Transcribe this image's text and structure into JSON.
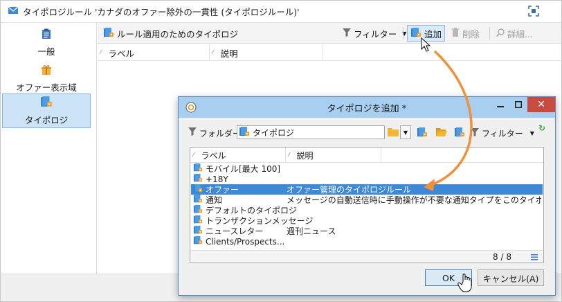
{
  "window": {
    "title": "タイポロジルール 'カナダのオファー除外の一貫性 (タイポロジルール)'"
  },
  "sidebar": {
    "items": [
      {
        "label": "一般",
        "icon": "clipboard-icon",
        "active": false
      },
      {
        "label": "オファー表示域",
        "icon": "gift-icon",
        "active": false
      },
      {
        "label": "タイポロジ",
        "icon": "typology-folder-icon",
        "active": true
      }
    ]
  },
  "toolbar": {
    "section_title": "ルール適用のためのタイポロジ",
    "filter_label": "フィルター",
    "add_label": "追加",
    "delete_label": "削除",
    "details_label": "詳細..."
  },
  "list": {
    "columns": [
      "ラベル",
      "説明"
    ]
  },
  "dialog": {
    "title": "タイポロジを追加 *",
    "folder_label": "フォルダー:",
    "folder_value": "タイポロジ",
    "filter_label": "フィルター",
    "columns": [
      "ラベル",
      "説明"
    ],
    "rows": [
      {
        "label": "モバイル[最大 100]",
        "description": "",
        "selected": false
      },
      {
        "label": "+18Y",
        "description": "",
        "selected": false
      },
      {
        "label": "オファー",
        "description": "オファー管理のタイポロジルール",
        "selected": true
      },
      {
        "label": "通知",
        "description": "メッセージの自動送信時に手動操作が不要な通知タイプをこのタイポロジ...",
        "selected": false
      },
      {
        "label": "デフォルトのタイポロジ",
        "description": "",
        "selected": false
      },
      {
        "label": "トランザクションメッセージ",
        "description": "",
        "selected": false
      },
      {
        "label": "ニュースレター",
        "description": "週刊ニュース",
        "selected": false
      },
      {
        "label": "Clients/Prospects...",
        "description": "",
        "selected": false
      }
    ],
    "count": "8 / 8",
    "ok_label": "OK",
    "cancel_label": "キャンセル(A)"
  },
  "colors": {
    "accent": "#3d89d6",
    "dialog_title_bg": "#a8cff0",
    "close_button": "#c74b41",
    "annotation_arrow": "#f0913a",
    "sidebar_active": "#cde4f7"
  }
}
